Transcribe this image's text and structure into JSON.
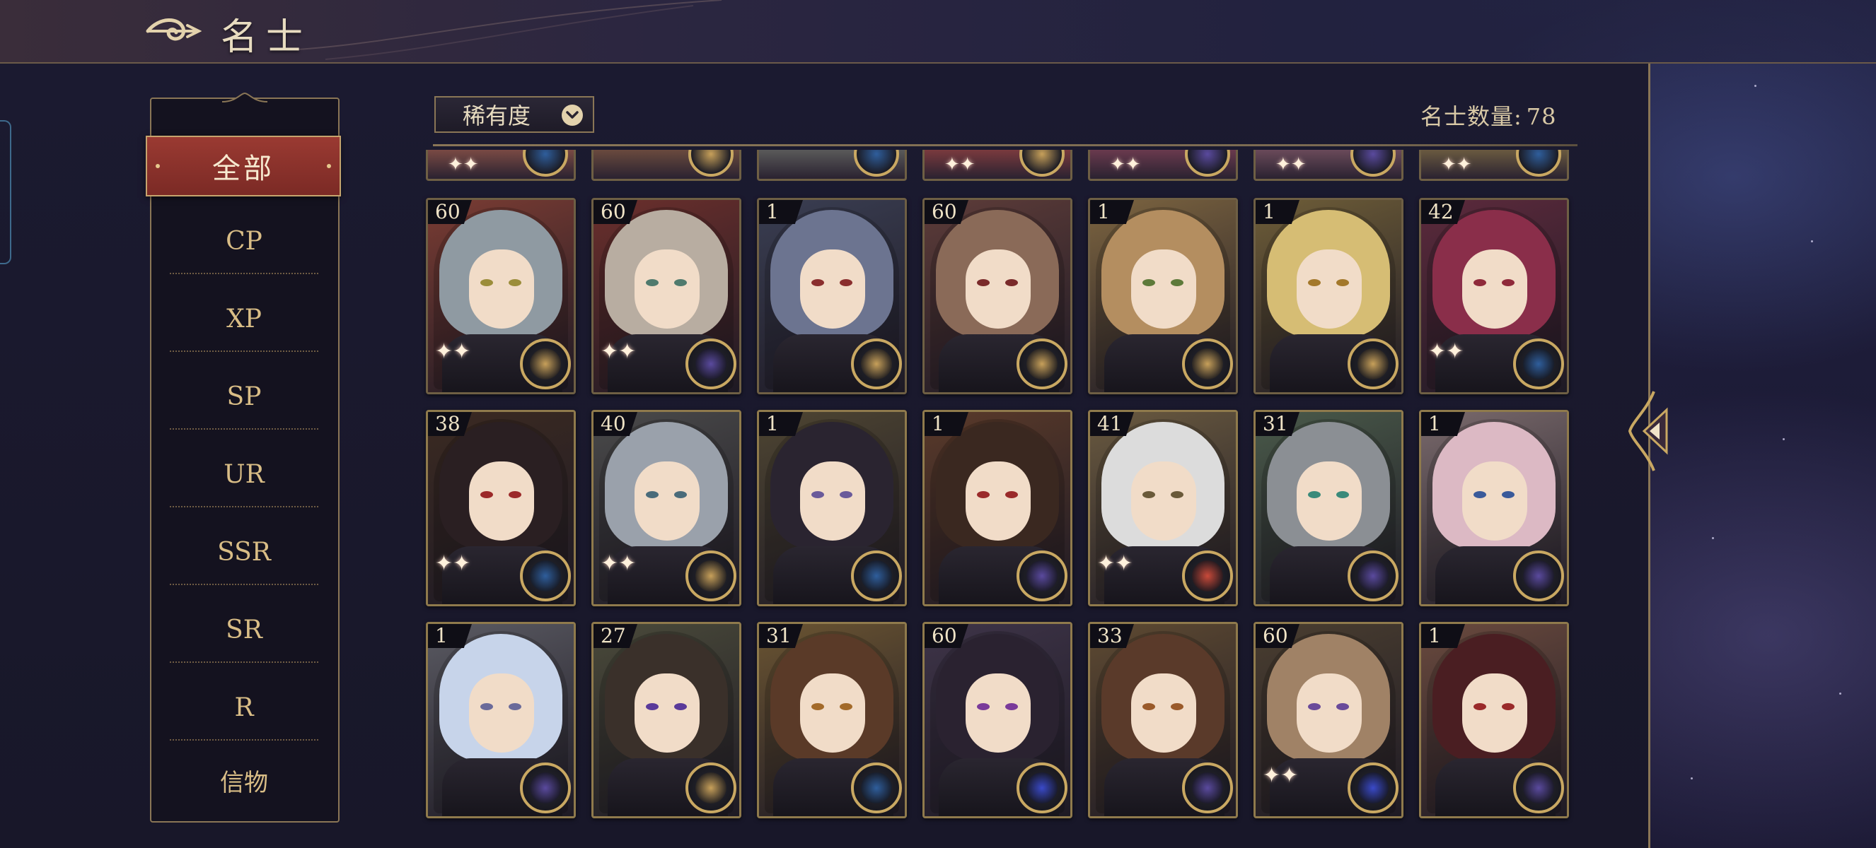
{
  "header": {
    "title": "名士"
  },
  "sidebar": {
    "categories": [
      {
        "label": "全部",
        "active": true
      },
      {
        "label": "CP"
      },
      {
        "label": "XP"
      },
      {
        "label": "SP"
      },
      {
        "label": "UR"
      },
      {
        "label": "SSR"
      },
      {
        "label": "SR"
      },
      {
        "label": "R"
      },
      {
        "label": "信物"
      }
    ]
  },
  "toolbar": {
    "filter_label": "稀有度",
    "count_label": "名士数量:",
    "count_value": "78"
  },
  "colors": {
    "accent_gold": "#c9a862",
    "active_red": "#8e332c",
    "text_gold": "#d9bd86"
  },
  "cards": [
    {
      "level": "60",
      "hair": "#8f9aa2",
      "bg": "#7a3c33",
      "eye": "#9b8d3a",
      "emblem": "#c7a05a",
      "sparkles": true
    },
    {
      "level": "60",
      "hair": "#b8ada1",
      "bg": "#6b2f2c",
      "eye": "#4f7a6d",
      "emblem": "#5a4a9e",
      "sparkles": true
    },
    {
      "level": "1",
      "hair": "#6c7490",
      "bg": "#3a3e52",
      "eye": "#8a2e2e",
      "emblem": "#c7a05a",
      "sparkles": false
    },
    {
      "level": "60",
      "hair": "#8a6a58",
      "bg": "#5d3c39",
      "eye": "#7a2a2a",
      "emblem": "#c7a05a",
      "sparkles": false
    },
    {
      "level": "1",
      "hair": "#b48e60",
      "bg": "#7c6440",
      "eye": "#5e7a3a",
      "emblem": "#c7a05a",
      "sparkles": false
    },
    {
      "level": "1",
      "hair": "#d6bd74",
      "bg": "#6e5d38",
      "eye": "#a3782a",
      "emblem": "#c7a05a",
      "sparkles": false
    },
    {
      "level": "42",
      "hair": "#8a2e4a",
      "bg": "#5c2a3c",
      "eye": "#8f2a3a",
      "emblem": "#2f5e9c",
      "sparkles": true
    },
    {
      "level": "38",
      "hair": "#2a1f22",
      "bg": "#3b2a22",
      "eye": "#9c2a2a",
      "emblem": "#2f5e9c",
      "sparkles": true
    },
    {
      "level": "40",
      "hair": "#9aa1ab",
      "bg": "#4a4a4a",
      "eye": "#4a6b7a",
      "emblem": "#c7a05a",
      "sparkles": true
    },
    {
      "level": "1",
      "hair": "#2a2430",
      "bg": "#4e4532",
      "eye": "#6a5a9a",
      "emblem": "#2f5e9c",
      "sparkles": false
    },
    {
      "level": "1",
      "hair": "#3a2820",
      "bg": "#5a3a2a",
      "eye": "#9a2a2a",
      "emblem": "#5a4a9e",
      "sparkles": false
    },
    {
      "level": "41",
      "hair": "#dcdcdc",
      "bg": "#6a5a40",
      "eye": "#6a5a3a",
      "emblem": "#c94a3a",
      "sparkles": true
    },
    {
      "level": "31",
      "hair": "#8b8f94",
      "bg": "#4a5a4a",
      "eye": "#3a8a7a",
      "emblem": "#5a4a9e",
      "sparkles": false
    },
    {
      "level": "1",
      "hair": "#dcb9c4",
      "bg": "#7a6a6c",
      "eye": "#3a5a9a",
      "emblem": "#5a4a9e",
      "sparkles": false
    },
    {
      "level": "1",
      "hair": "#c7d4ea",
      "bg": "#5a5a62",
      "eye": "#6a6a9a",
      "emblem": "#5a4a9e",
      "sparkles": false
    },
    {
      "level": "27",
      "hair": "#3a302a",
      "bg": "#4a4a3a",
      "eye": "#5a3a9a",
      "emblem": "#c7a05a",
      "sparkles": false
    },
    {
      "level": "31",
      "hair": "#5a3a28",
      "bg": "#6a5432",
      "eye": "#a36a2a",
      "emblem": "#2f5e9c",
      "sparkles": false
    },
    {
      "level": "60",
      "hair": "#2a2230",
      "bg": "#3e3448",
      "eye": "#7a3a9a",
      "emblem": "#3a4ac9",
      "sparkles": false
    },
    {
      "level": "33",
      "hair": "#5a3a2a",
      "bg": "#5e4a32",
      "eye": "#9a5a2a",
      "emblem": "#5a4a9e",
      "sparkles": false
    },
    {
      "level": "60",
      "hair": "#a08266",
      "bg": "#4a3e30",
      "eye": "#6a4a9a",
      "emblem": "#3a4ac9",
      "sparkles": true
    },
    {
      "level": "1",
      "hair": "#4a1e22",
      "bg": "#6a4a3e",
      "eye": "#9a2a2a",
      "emblem": "#5a4a9e",
      "sparkles": false
    }
  ],
  "partial_row": [
    {
      "bg": "#7a4a44",
      "emblem": "#2f5e9c",
      "sparkles": true
    },
    {
      "bg": "#6a4a3e",
      "emblem": "#c7a05a",
      "sparkles": false
    },
    {
      "bg": "#5a5a5a",
      "emblem": "#2f5e9c",
      "sparkles": false
    },
    {
      "bg": "#7a3a3e",
      "emblem": "#c7a05a",
      "sparkles": true
    },
    {
      "bg": "#6a3a4e",
      "emblem": "#5a4a9e",
      "sparkles": true
    },
    {
      "bg": "#6a4a5a",
      "emblem": "#5a4a9e",
      "sparkles": true
    },
    {
      "bg": "#6a5a40",
      "emblem": "#2f5e9c",
      "sparkles": true
    }
  ]
}
